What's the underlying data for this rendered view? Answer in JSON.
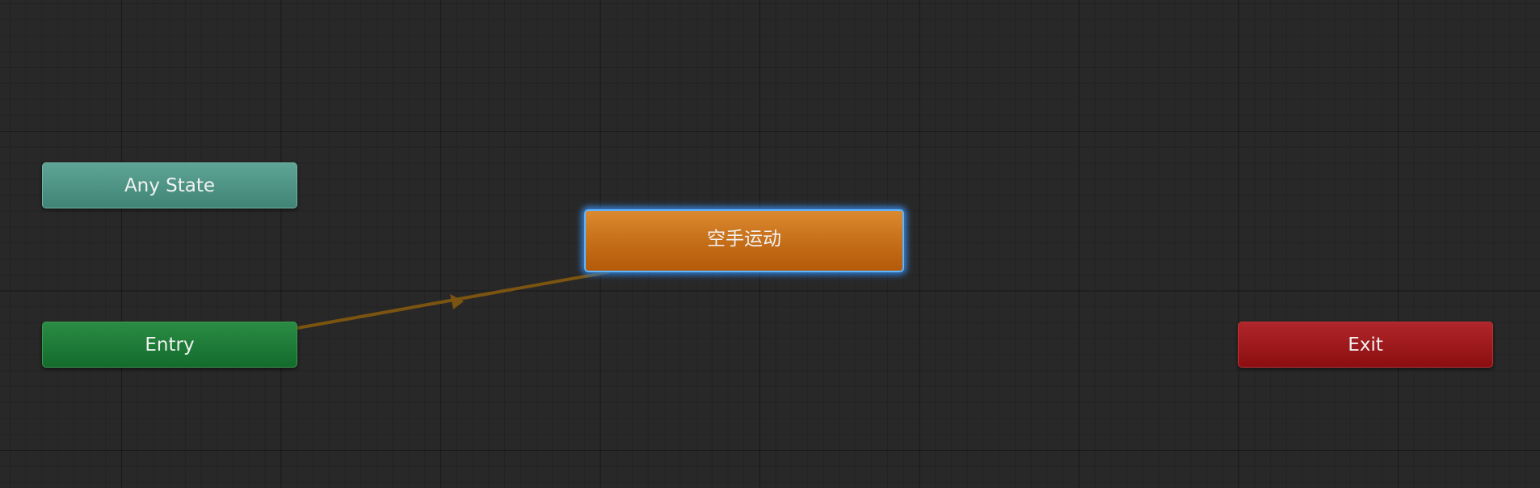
{
  "nodes": {
    "any_state": {
      "label": "Any State",
      "color": "#4f9585"
    },
    "entry": {
      "label": "Entry",
      "color": "#1d7a36"
    },
    "exit": {
      "label": "Exit",
      "color": "#9c1a1d"
    },
    "default_state": {
      "label": "空手运动",
      "color": "#c87018",
      "selected": true
    }
  },
  "transitions": [
    {
      "from": "Entry",
      "to": "空手运动",
      "color": "#7a5410"
    }
  ]
}
